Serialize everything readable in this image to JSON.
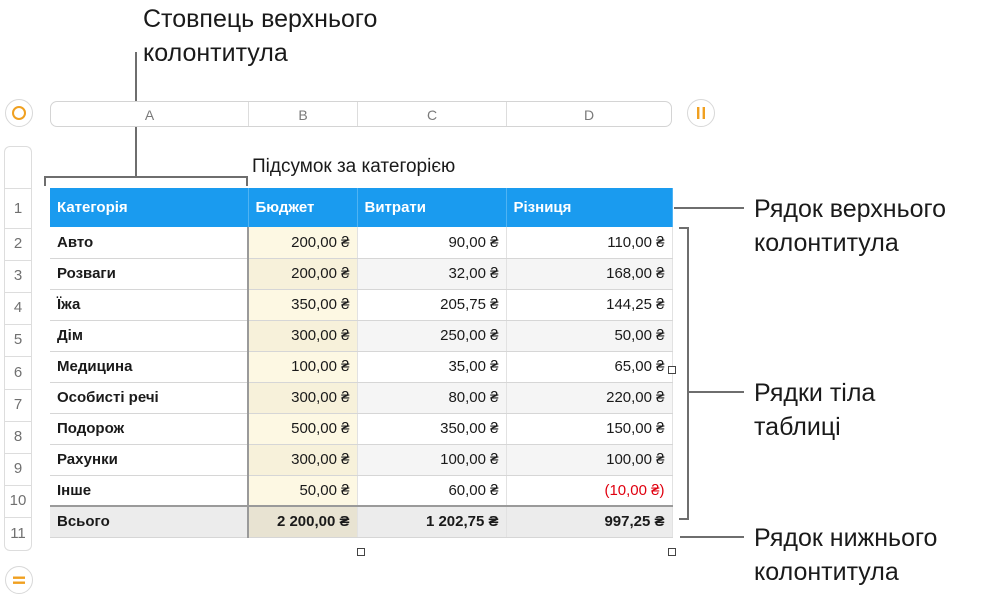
{
  "callouts": {
    "header_column": "Стовпець верхнього колонтитула",
    "header_row": "Рядок верхнього колонтитула",
    "body_rows": "Рядки тіла таблиці",
    "footer_row": "Рядок нижнього колонтитула"
  },
  "column_letters": [
    "A",
    "B",
    "C",
    "D"
  ],
  "row_numbers": [
    "1",
    "2",
    "3",
    "4",
    "5",
    "6",
    "7",
    "8",
    "9",
    "10",
    "11"
  ],
  "table": {
    "title": "Підсумок за категорією",
    "headers": [
      "Категорія",
      "Бюджет",
      "Витрати",
      "Різниця"
    ],
    "rows": [
      {
        "category": "Авто",
        "budget": "200,00 ₴",
        "expenses": "90,00 ₴",
        "difference": "110,00 ₴"
      },
      {
        "category": "Розваги",
        "budget": "200,00 ₴",
        "expenses": "32,00 ₴",
        "difference": "168,00 ₴"
      },
      {
        "category": "Їжа",
        "budget": "350,00 ₴",
        "expenses": "205,75 ₴",
        "difference": "144,25 ₴"
      },
      {
        "category": "Дім",
        "budget": "300,00 ₴",
        "expenses": "250,00 ₴",
        "difference": "50,00 ₴"
      },
      {
        "category": "Медицина",
        "budget": "100,00 ₴",
        "expenses": "35,00 ₴",
        "difference": "65,00 ₴"
      },
      {
        "category": "Особисті речі",
        "budget": "300,00 ₴",
        "expenses": "80,00 ₴",
        "difference": "220,00 ₴"
      },
      {
        "category": "Подорож",
        "budget": "500,00 ₴",
        "expenses": "350,00 ₴",
        "difference": "150,00 ₴"
      },
      {
        "category": "Рахунки",
        "budget": "300,00 ₴",
        "expenses": "100,00 ₴",
        "difference": "100,00 ₴"
      },
      {
        "category": "Інше",
        "budget": "50,00 ₴",
        "expenses": "60,00 ₴",
        "difference": "(10,00 ₴)"
      }
    ],
    "footer": {
      "category": "Всього",
      "budget": "2 200,00 ₴",
      "expenses": "1 202,75 ₴",
      "difference": "997,25 ₴"
    }
  },
  "icons": {
    "select_table": "circle-icon",
    "column_handle": "pause-bars-icon",
    "row_handle": "equals-icon"
  },
  "colors": {
    "header_fill": "#1a9bef",
    "accent": "#f0a020",
    "negative": "#e0000f"
  }
}
